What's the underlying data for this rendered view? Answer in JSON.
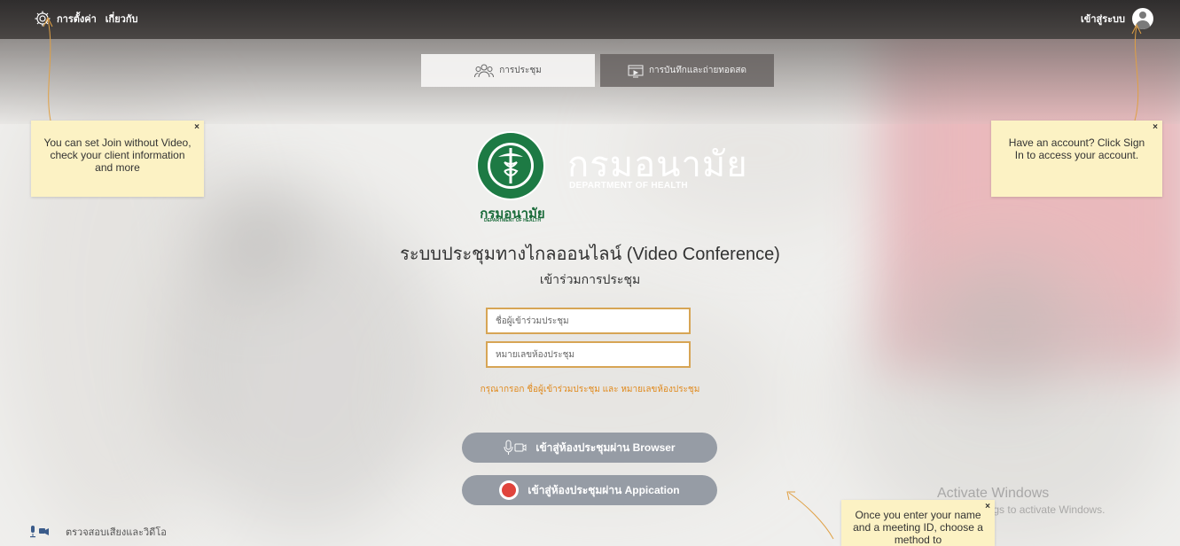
{
  "topbar": {
    "settings_label": "การตั้งค่า",
    "about_label": "เกี่ยวกับ",
    "signin_label": "เข้าสู่ระบบ"
  },
  "tabs": [
    {
      "label": "การประชุม",
      "active": true
    },
    {
      "label": "การบันทึกและถ่ายทอดสด",
      "active": false
    }
  ],
  "tooltips": {
    "settings": "You can set Join without Video, check your client information and more",
    "signin": "Have an account? Click Sign In to access your account.",
    "join": "Once you enter your name and a meeting ID, choose a method to",
    "close_symbol": "×"
  },
  "logo": {
    "th_name": "กรมอนามัย",
    "en_name": "DEPARTMENT OF HEALTH",
    "seal_text": "MINISTRY OF PUBLIC HEALTH"
  },
  "heading": {
    "title": "ระบบประชุมทางไกลออนไลน์ (Video Conference)",
    "subtitle": "เข้าร่วมการประชุม"
  },
  "form": {
    "name_placeholder": "ชื่อผู้เข้าร่วมประชุม",
    "meeting_id_placeholder": "หมายเลขห้องประชุม",
    "hint": "กรุณากรอก ชื่อผู้เข้าร่วมประชุม และ หมายเลขห้องประชุม"
  },
  "buttons": {
    "browser_label": "เข้าสู่ห้องประชุมผ่าน Browser",
    "app_label": "เข้าสู่ห้องประชุมผ่าน Appication"
  },
  "footer": {
    "av_check_label": "ตรวจสอบเสียงและวิดีโอ"
  },
  "watermark": {
    "line1": "Activate Windows",
    "line2": "Go to Settings to activate Windows."
  },
  "colors": {
    "accent": "#e08a1e",
    "tooltip_bg": "#fcf2c4",
    "button_bg": "#969ca5",
    "field_border": "#d7a555"
  }
}
